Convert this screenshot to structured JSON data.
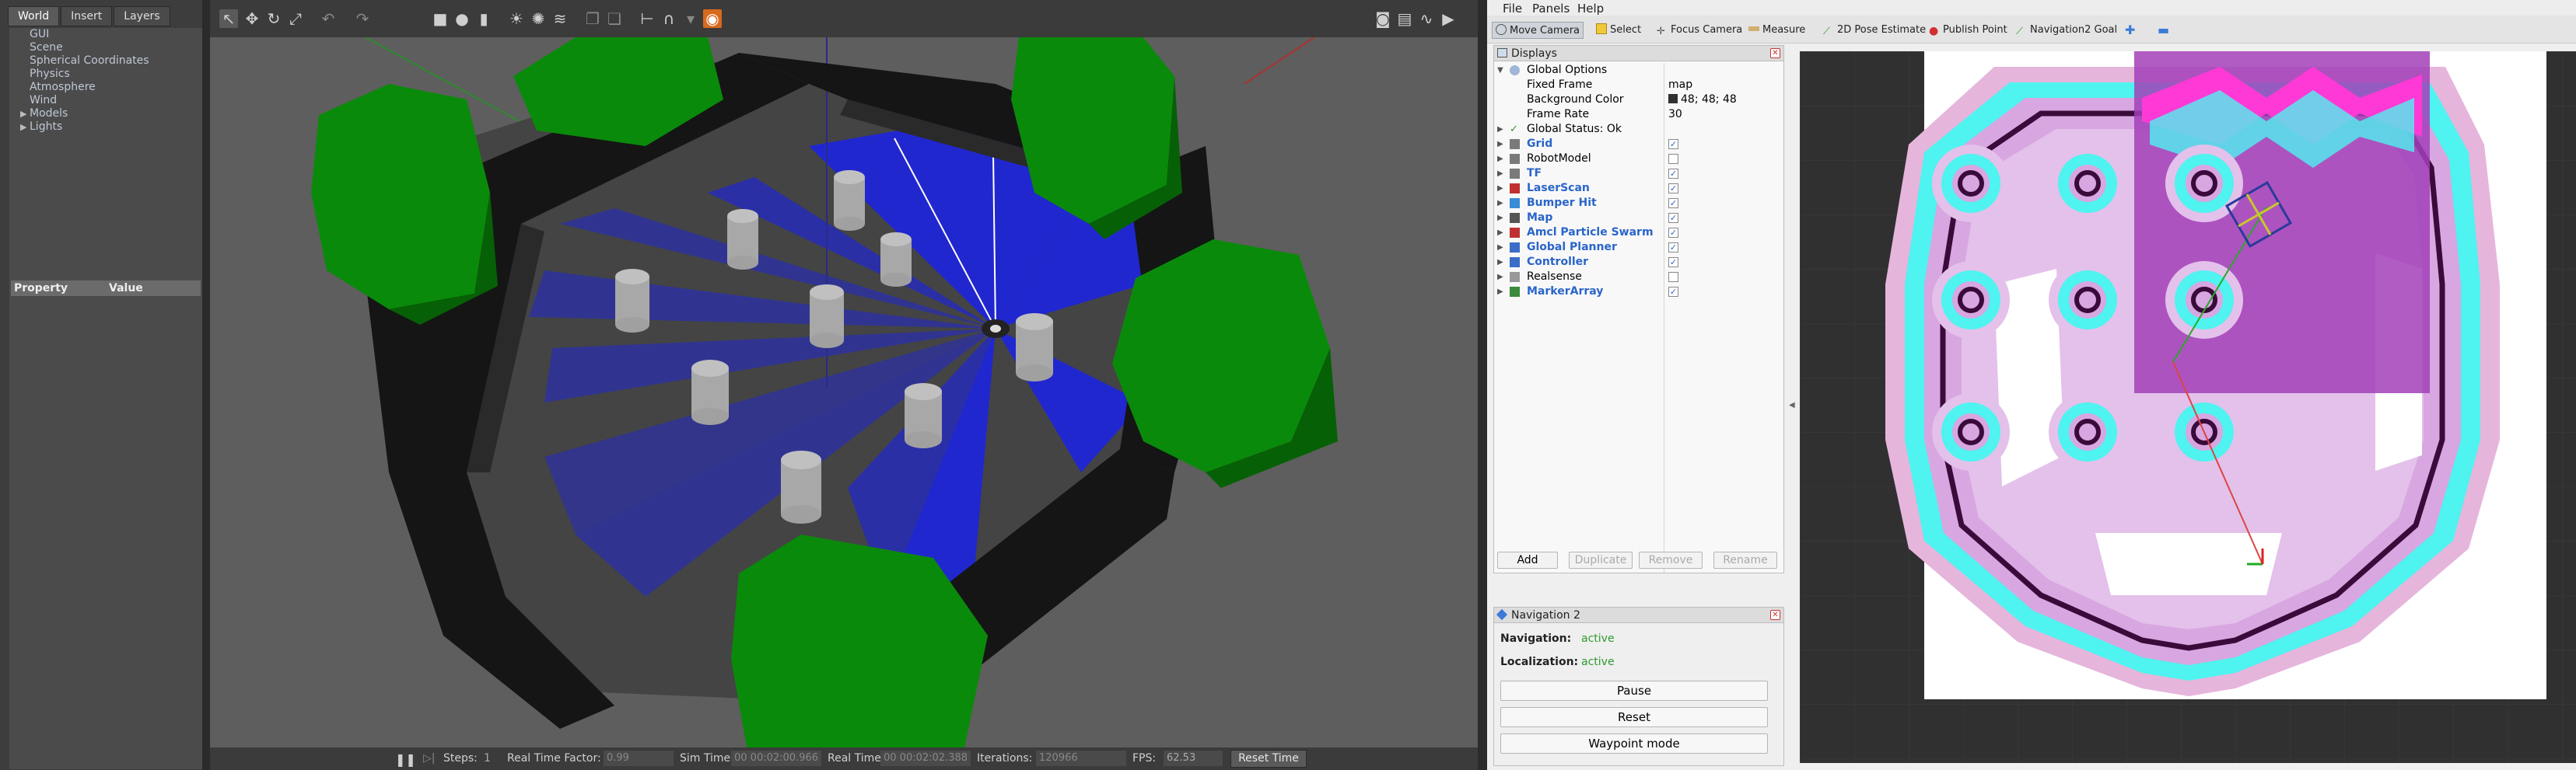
{
  "gazebo": {
    "tabs": [
      "World",
      "Insert",
      "Layers"
    ],
    "world_tree": {
      "items": [
        "GUI",
        "Scene",
        "Spherical Coordinates",
        "Physics",
        "Atmosphere",
        "Wind"
      ],
      "expandable": [
        "Models",
        "Lights"
      ]
    },
    "property_table": {
      "property_header": "Property",
      "value_header": "Value"
    },
    "bottom_bar": {
      "steps_label": "Steps:",
      "steps_value": "1",
      "real_time_factor_label": "Real Time Factor:",
      "real_time_factor_value": "0.99",
      "sim_time_label": "Sim Time:",
      "sim_time_value": "00 00:02:00.966",
      "real_time_label": "Real Time:",
      "real_time_value": "00 00:02:02.388",
      "iterations_label": "Iterations:",
      "iterations_value": "120966",
      "fps_label": "FPS:",
      "fps_value": "62.53",
      "reset_time": "Reset Time"
    }
  },
  "rviz": {
    "menu": [
      "File",
      "Panels",
      "Help"
    ],
    "toolbar": {
      "move_camera": "Move Camera",
      "select": "Select",
      "focus_camera": "Focus Camera",
      "measure": "Measure",
      "pose_estimate": "2D Pose Estimate",
      "publish_point": "Publish Point",
      "nav_goal": "Navigation2 Goal"
    },
    "displays": {
      "title": "Displays",
      "global_options": "Global Options",
      "fixed_frame_label": "Fixed Frame",
      "fixed_frame_value": "map",
      "bg_color_label": "Background Color",
      "bg_color_value": "48; 48; 48",
      "frame_rate_label": "Frame Rate",
      "frame_rate_value": "30",
      "global_status": "Global Status: Ok",
      "items": [
        {
          "name": "Grid",
          "checked": true,
          "color": "#7a7a7a"
        },
        {
          "name": "RobotModel",
          "checked": false,
          "color": "#7a7a7a"
        },
        {
          "name": "TF",
          "checked": true,
          "color": "#7a7a7a"
        },
        {
          "name": "LaserScan",
          "checked": true,
          "color": "#c03030"
        },
        {
          "name": "Bumper Hit",
          "checked": true,
          "color": "#3a8cd8"
        },
        {
          "name": "Map",
          "checked": true,
          "color": "#555"
        },
        {
          "name": "Amcl Particle Swarm",
          "checked": true,
          "color": "#c03030"
        },
        {
          "name": "Global Planner",
          "checked": true,
          "color": "#3a6cc8"
        },
        {
          "name": "Controller",
          "checked": true,
          "color": "#3a6cc8"
        },
        {
          "name": "Realsense",
          "checked": false,
          "color": "#999"
        },
        {
          "name": "MarkerArray",
          "checked": true,
          "color": "#3a8c3a"
        }
      ],
      "buttons": {
        "add": "Add",
        "duplicate": "Duplicate",
        "remove": "Remove",
        "rename": "Rename"
      }
    },
    "nav2": {
      "title": "Navigation 2",
      "navigation_label": "Navigation:",
      "navigation_value": "active",
      "localization_label": "Localization:",
      "localization_value": "active",
      "pause": "Pause",
      "reset": "Reset",
      "waypoint": "Waypoint mode"
    }
  },
  "colors": {
    "rviz_background": "#303030",
    "laser_blue": "#1a22e8",
    "wall_black": "#151515",
    "bush_green": "#0a8a0a",
    "costmap_cyan": "#4ff3f0",
    "costmap_magenta": "#d42ad4",
    "obstacle_dark": "#3a0a3a"
  }
}
